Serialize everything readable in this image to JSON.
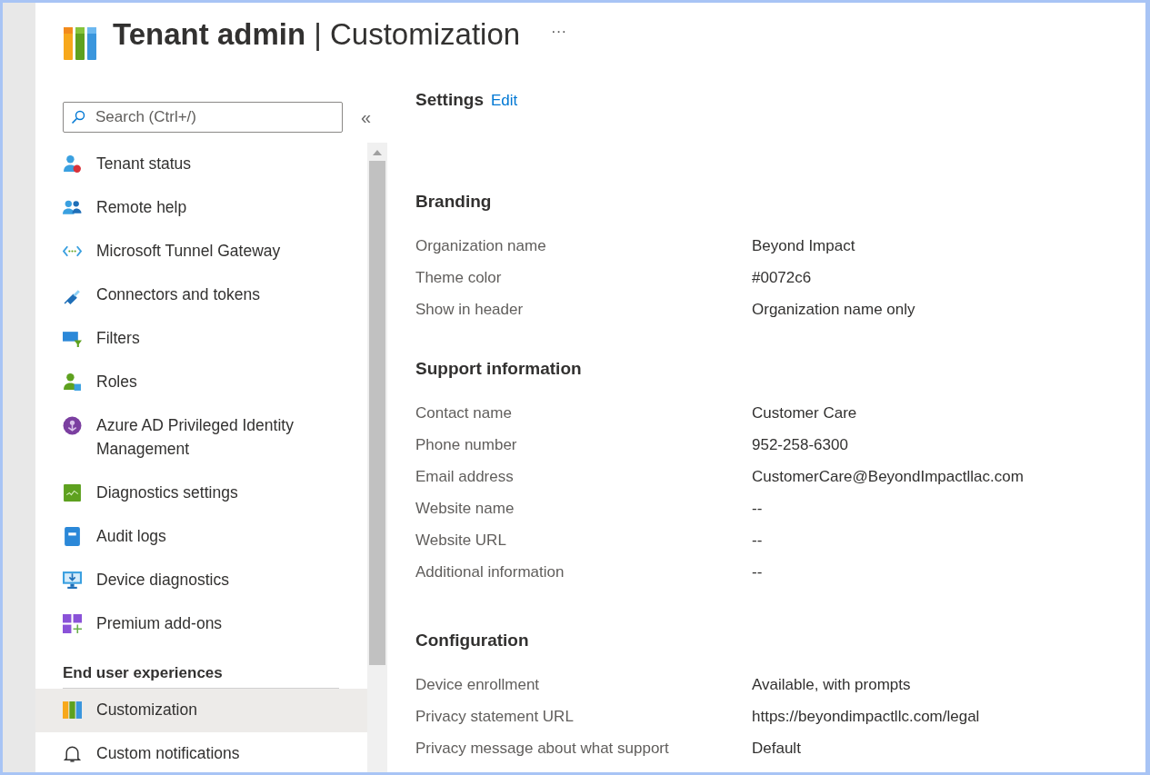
{
  "header": {
    "title_bold": "Tenant admin",
    "title_separator": "|",
    "title_rest": "Customization",
    "more": "···"
  },
  "sidebar": {
    "search": {
      "placeholder": "Search (Ctrl+/)"
    },
    "collapse": "«",
    "items": [
      {
        "label": "Tenant status",
        "selected": false
      },
      {
        "label": "Remote help",
        "selected": false
      },
      {
        "label": "Microsoft Tunnel Gateway",
        "selected": false
      },
      {
        "label": "Connectors and tokens",
        "selected": false
      },
      {
        "label": "Filters",
        "selected": false
      },
      {
        "label": "Roles",
        "selected": false
      },
      {
        "label": "Azure AD Privileged Identity Management",
        "selected": false
      },
      {
        "label": "Diagnostics settings",
        "selected": false
      },
      {
        "label": "Audit logs",
        "selected": false
      },
      {
        "label": "Device diagnostics",
        "selected": false
      },
      {
        "label": "Premium add-ons",
        "selected": false
      }
    ],
    "section": {
      "heading": "End user experiences",
      "items": [
        {
          "label": "Customization",
          "selected": true
        },
        {
          "label": "Custom notifications",
          "selected": false
        }
      ]
    }
  },
  "settings": {
    "title": "Settings",
    "edit": "Edit",
    "groups": [
      {
        "heading": "Branding",
        "rows": [
          {
            "label": "Organization name",
            "value": "Beyond Impact"
          },
          {
            "label": "Theme color",
            "value": "#0072c6"
          },
          {
            "label": "Show in header",
            "value": "Organization name only"
          }
        ]
      },
      {
        "heading": "Support information",
        "rows": [
          {
            "label": "Contact name",
            "value": "Customer Care"
          },
          {
            "label": "Phone number",
            "value": "952-258-6300"
          },
          {
            "label": "Email address",
            "value": "CustomerCare@BeyondImpactllac.com"
          },
          {
            "label": "Website name",
            "value": "--"
          },
          {
            "label": "Website URL",
            "value": "--"
          },
          {
            "label": "Additional information",
            "value": "--"
          }
        ]
      },
      {
        "heading": "Configuration",
        "rows": [
          {
            "label": "Device enrollment",
            "value": "Available, with prompts"
          },
          {
            "label": "Privacy statement URL",
            "value": "https://beyondimpactllc.com/legal"
          },
          {
            "label": "Privacy message about what support",
            "value": "Default"
          }
        ]
      }
    ]
  }
}
